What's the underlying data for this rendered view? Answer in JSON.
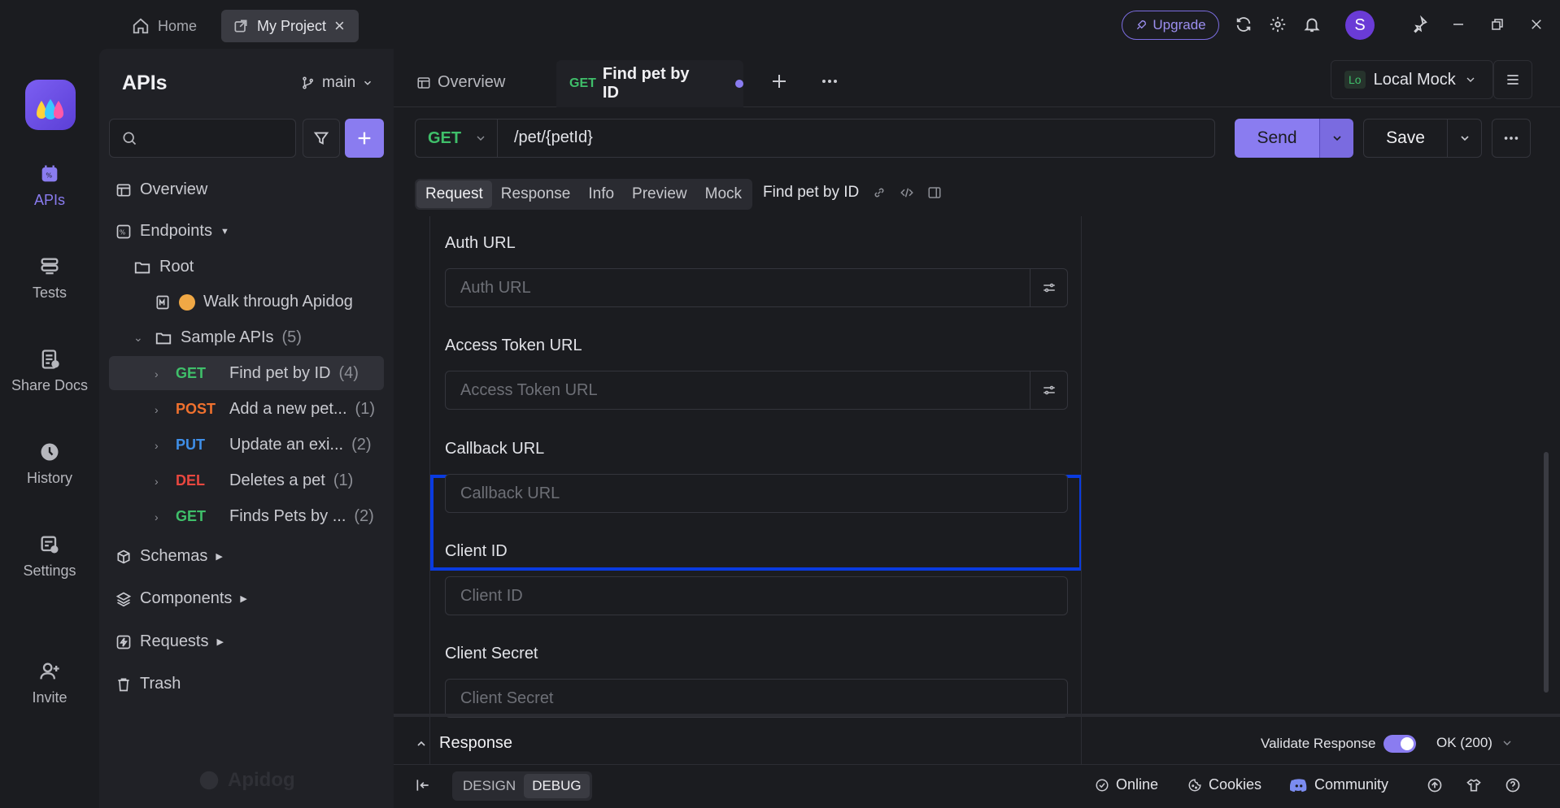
{
  "titlebar": {
    "tabs": [
      {
        "label": "Home",
        "icon": "home-icon"
      },
      {
        "label": "My Project",
        "icon": "external-link-icon",
        "close": "×"
      }
    ],
    "upgrade_label": "Upgrade",
    "avatar_initial": "S"
  },
  "rail": {
    "items": [
      {
        "label": "APIs",
        "icon": "apis-icon",
        "active": true
      },
      {
        "label": "Tests",
        "icon": "tests-icon"
      },
      {
        "label": "Share Docs",
        "icon": "share-docs-icon"
      },
      {
        "label": "History",
        "icon": "history-icon"
      },
      {
        "label": "Settings",
        "icon": "settings-icon"
      },
      {
        "label": "Invite",
        "icon": "invite-icon"
      }
    ]
  },
  "sidebar": {
    "title": "APIs",
    "branch": "main",
    "search_placeholder": "",
    "overview": "Overview",
    "endpoints": "Endpoints",
    "root": "Root",
    "walkthrough": "Walk through Apidog",
    "sample_folder": "Sample APIs",
    "sample_count": "(5)",
    "endpoints_list": [
      {
        "method": "GET",
        "name": "Find pet by ID",
        "count": "(4)"
      },
      {
        "method": "POST",
        "name": "Add a new pet...",
        "count": "(1)"
      },
      {
        "method": "PUT",
        "name": "Update an exi...",
        "count": "(2)"
      },
      {
        "method": "DEL",
        "name": "Deletes a pet",
        "count": "(1)"
      },
      {
        "method": "GET",
        "name": "Finds Pets by ...",
        "count": "(2)"
      }
    ],
    "schemas": "Schemas",
    "components": "Components",
    "requests": "Requests",
    "trash": "Trash",
    "watermark": "Apidog"
  },
  "tabs": {
    "overview": "Overview",
    "active_method": "GET",
    "active_name": "Find pet by ID",
    "environment_badge": "Lo",
    "environment": "Local Mock"
  },
  "request": {
    "method": "GET",
    "path": "/pet/{petId}",
    "send": "Send",
    "save": "Save"
  },
  "subtabs": [
    "Request",
    "Response",
    "Info",
    "Preview",
    "Mock"
  ],
  "subtabs_title": "Find pet by ID",
  "fields": [
    {
      "label": "Auth URL",
      "placeholder": "Auth URL"
    },
    {
      "label": "Access Token URL",
      "placeholder": "Access Token URL"
    },
    {
      "label": "Callback URL",
      "placeholder": "Callback URL"
    },
    {
      "label": "Client ID",
      "placeholder": "Client ID"
    },
    {
      "label": "Client Secret",
      "placeholder": "Client Secret"
    }
  ],
  "response_bar": {
    "title": "Response",
    "validate": "Validate Response",
    "status": "OK (200)"
  },
  "statusbar": {
    "design": "DESIGN",
    "debug": "DEBUG",
    "online": "Online",
    "cookies": "Cookies",
    "community": "Community"
  },
  "colors": {
    "accent": "#8a7cf0",
    "get": "#3fbf6a",
    "post": "#f0712e",
    "put": "#3f8fe8",
    "delete": "#e8473f",
    "highlight": "#0a3be0"
  }
}
